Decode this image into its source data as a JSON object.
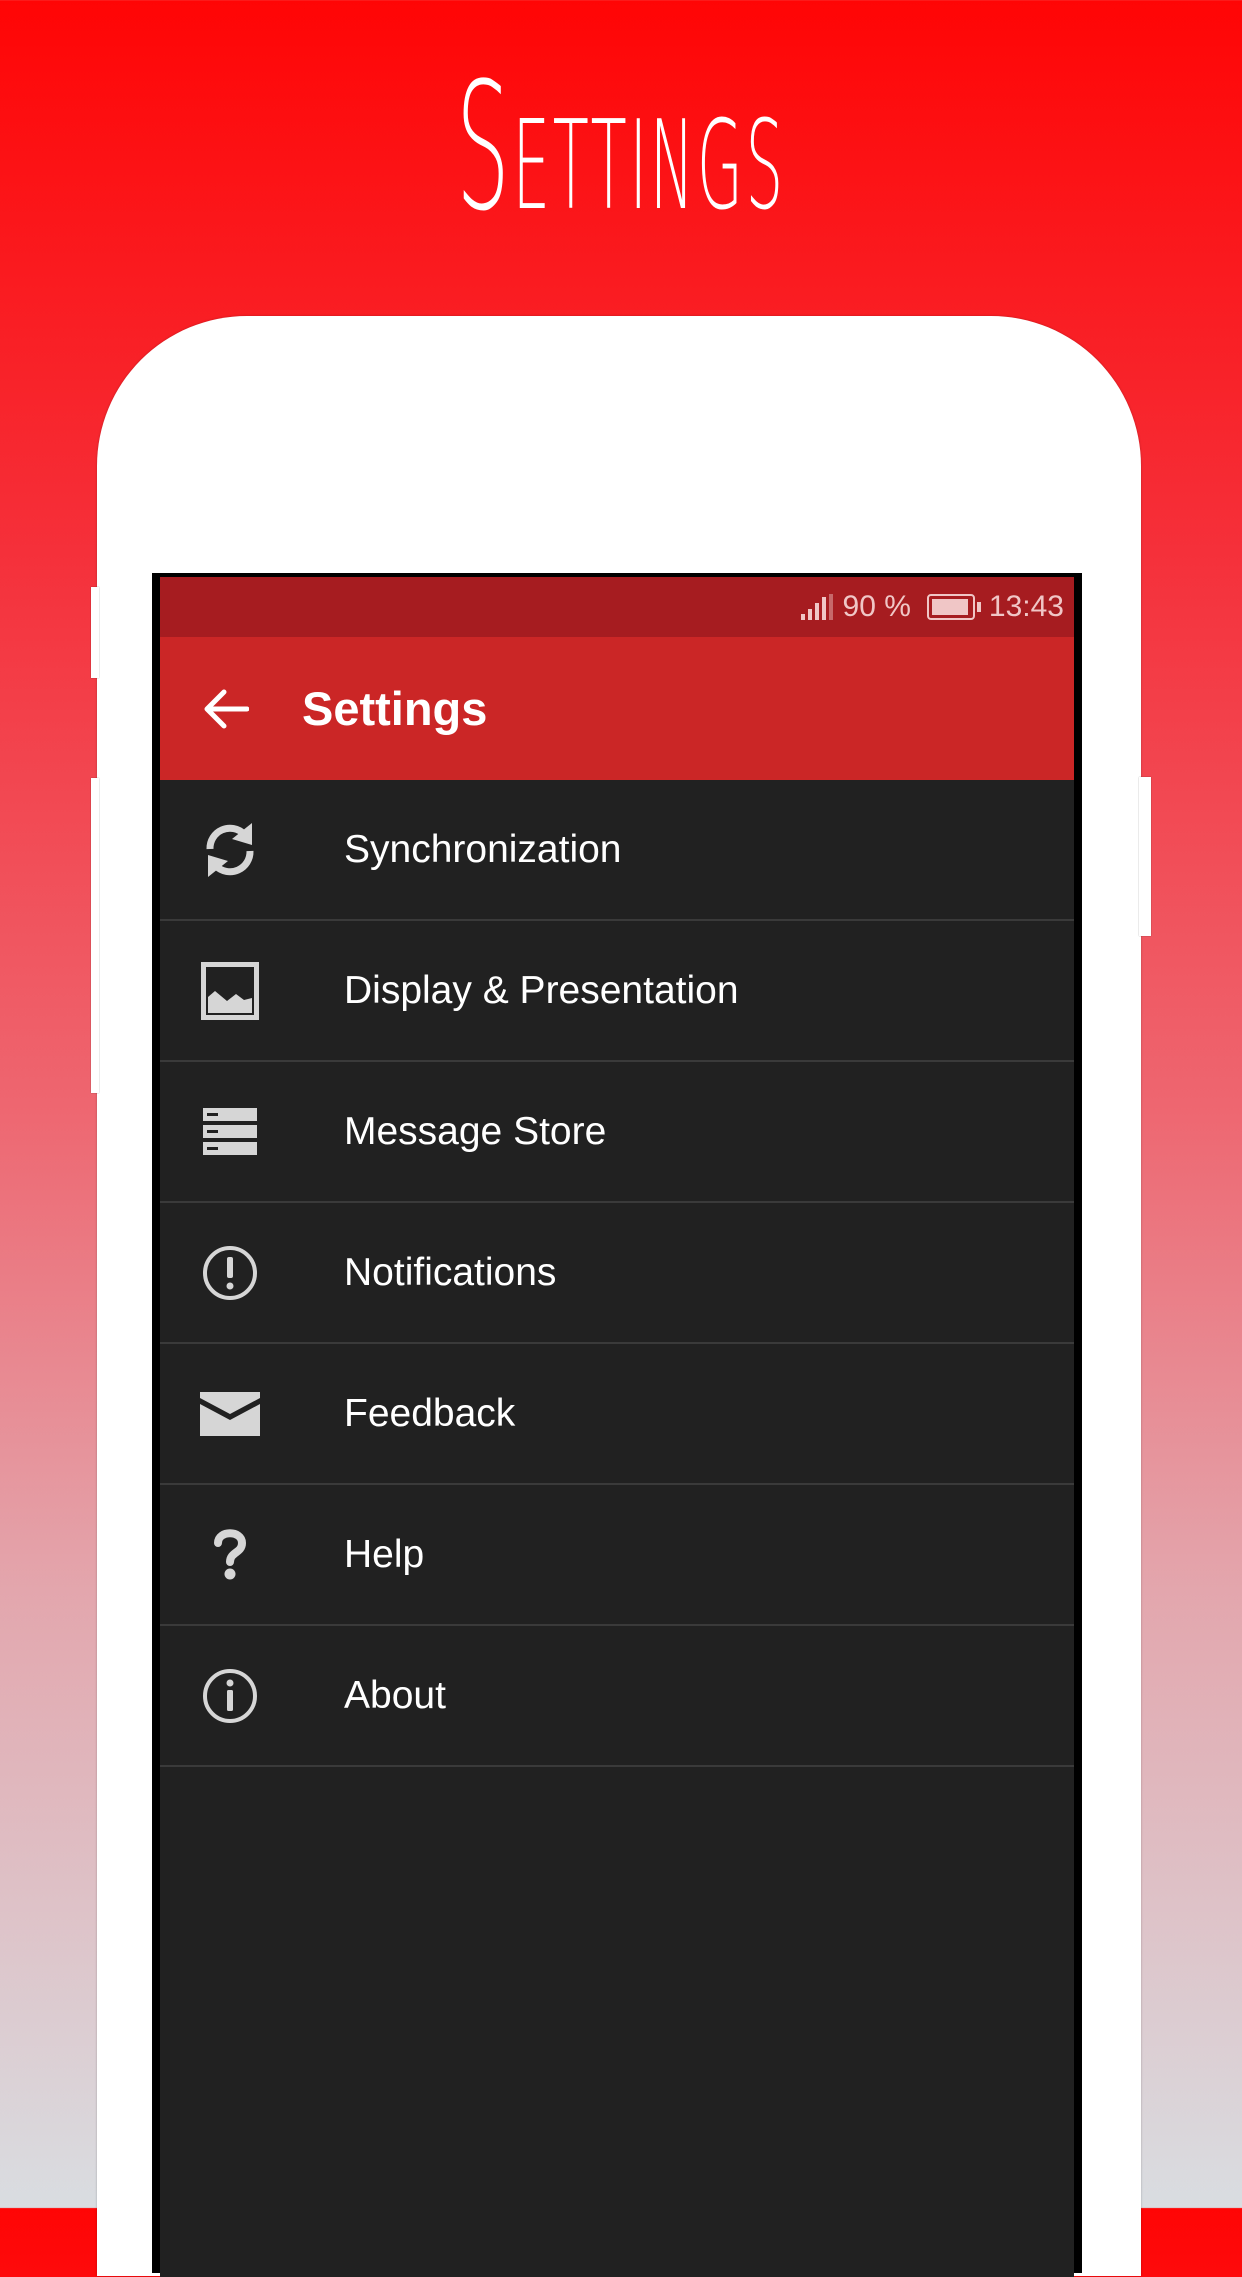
{
  "hero": {
    "title": "Settings"
  },
  "status_bar": {
    "signal_icon": "signal-bars-icon",
    "battery_percent": "90 %",
    "battery_icon": "battery-icon",
    "time": "13:43"
  },
  "toolbar": {
    "back_icon": "arrow-left-icon",
    "title": "Settings"
  },
  "menu": {
    "items": [
      {
        "label": "Synchronization",
        "icon": "sync-icon"
      },
      {
        "label": "Display & Presentation",
        "icon": "image-icon"
      },
      {
        "label": "Message Store",
        "icon": "storage-icon"
      },
      {
        "label": "Notifications",
        "icon": "alert-circle-icon"
      },
      {
        "label": "Feedback",
        "icon": "envelope-icon"
      },
      {
        "label": "Help",
        "icon": "question-mark-icon"
      },
      {
        "label": "About",
        "icon": "info-circle-icon"
      }
    ]
  },
  "colors": {
    "status_bar": "#a61c20",
    "toolbar": "#cb2626",
    "list_background": "#212121",
    "divider": "#3a3a3a",
    "icon": "#d6d6d6"
  }
}
